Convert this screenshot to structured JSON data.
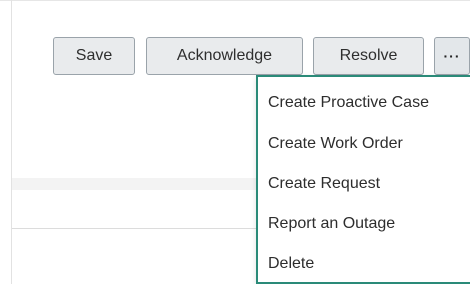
{
  "toolbar": {
    "save_label": "Save",
    "acknowledge_label": "Acknowledge",
    "resolve_label": "Resolve",
    "more_label": "···"
  },
  "menu": {
    "items": [
      {
        "label": "Create Proactive Case"
      },
      {
        "label": "Create Work Order"
      },
      {
        "label": "Create Request"
      },
      {
        "label": "Report an Outage"
      },
      {
        "label": "Delete"
      }
    ]
  },
  "colors": {
    "menu_border": "#2a8a78",
    "button_background": "#e9ebed",
    "button_border": "#9aa3aa"
  },
  "icons": {
    "more": "more-horizontal-icon"
  }
}
